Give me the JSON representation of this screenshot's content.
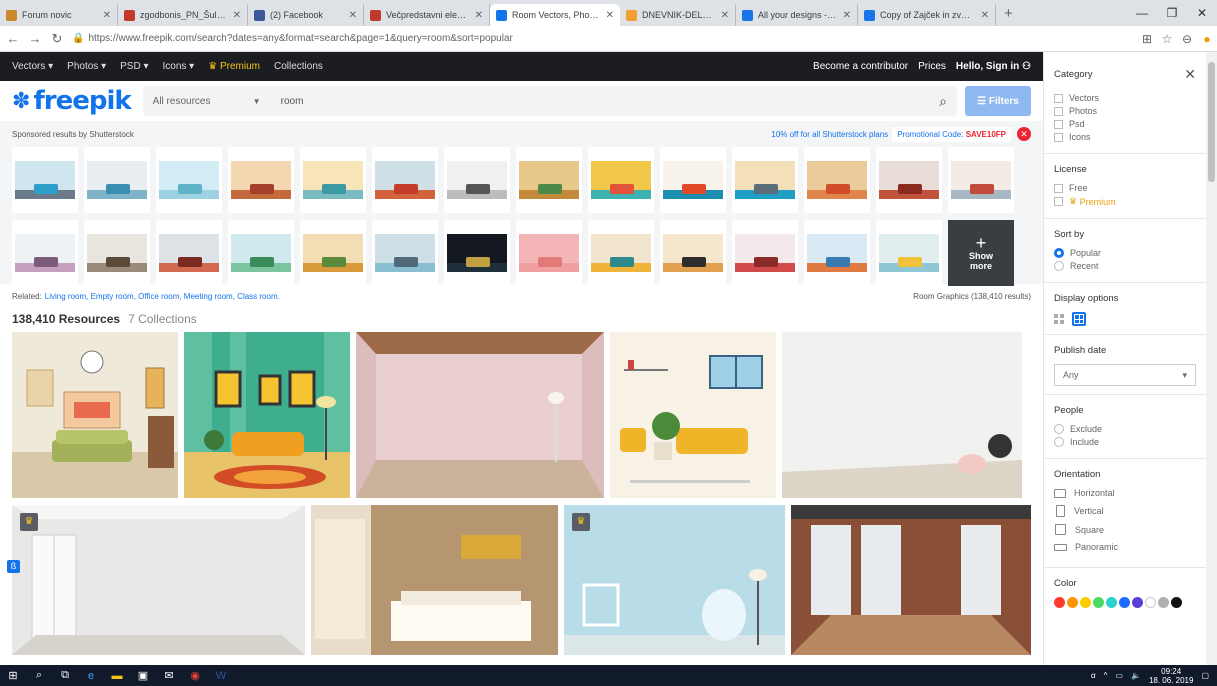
{
  "browser": {
    "tabs": [
      {
        "title": "Forum novic",
        "active": false,
        "color": "#c98a2a"
      },
      {
        "title": "zgodbonis_PN_Šultaršič_Ra",
        "active": false,
        "color": "#c0392b"
      },
      {
        "title": "(2) Facebook",
        "active": false,
        "color": "#3b5998"
      },
      {
        "title": "Večpredstavni elementi – Z",
        "active": false,
        "color": "#c0392b"
      },
      {
        "title": "Room Vectors, Photos and",
        "active": true,
        "color": "#1273eb"
      },
      {
        "title": "DNEVNIK-DELA.pdf",
        "active": false,
        "color": "#f0a030"
      },
      {
        "title": "All your designs - Canva",
        "active": false,
        "color": "#1a73e8"
      },
      {
        "title": "Copy of Zajček in zvonček",
        "active": false,
        "color": "#1a73e8"
      }
    ],
    "url": "https://www.freepik.com/search?dates=any&format=search&page=1&query=room&sort=popular"
  },
  "topnav": {
    "items": [
      "Vectors",
      "Photos",
      "PSD",
      "Icons"
    ],
    "premium": "Premium",
    "collections": "Collections",
    "contributor": "Become a contributor",
    "prices": "Prices",
    "signin": "Hello, Sign in"
  },
  "search": {
    "logo": "freepik",
    "category": "All resources",
    "query": "room",
    "filters": "Filters"
  },
  "sponsor": {
    "label": "Sponsored results by Shutterstock",
    "promo": "10% off for all Shutterstock plans",
    "code_label": "Promotional Code:",
    "code": "SAVE10FP",
    "show_more_1": "Show",
    "show_more_2": "more"
  },
  "related": {
    "label": "Related:",
    "links": "Living room, Empty room, Office room, Meeting room, Class room.",
    "graphics": "Room Graphics (138,410 results)"
  },
  "results": {
    "count": "138,410 Resources",
    "collections": "7 Collections"
  },
  "sidebar": {
    "category": {
      "title": "Category",
      "options": [
        "Vectors",
        "Photos",
        "Psd",
        "Icons"
      ]
    },
    "license": {
      "title": "License",
      "options": [
        "Free",
        "Premium"
      ]
    },
    "sort": {
      "title": "Sort by",
      "options": [
        "Popular",
        "Recent"
      ],
      "selected": "Popular"
    },
    "display": {
      "title": "Display options"
    },
    "publish": {
      "title": "Publish date",
      "value": "Any"
    },
    "people": {
      "title": "People",
      "options": [
        "Exclude",
        "Include"
      ]
    },
    "orientation": {
      "title": "Orientation",
      "options": [
        "Horizontal",
        "Vertical",
        "Square",
        "Panoramic"
      ]
    },
    "color": {
      "title": "Color",
      "swatches": [
        "#ff3b30",
        "#ff9500",
        "#ffcc00",
        "#4cd964",
        "#2ecfcf",
        "#1e6bff",
        "#5a3fd9",
        "#ffffff",
        "#b0b0b0",
        "#111111"
      ]
    }
  },
  "taskbar": {
    "time": "09:24",
    "date": "18. 06. 2019"
  }
}
